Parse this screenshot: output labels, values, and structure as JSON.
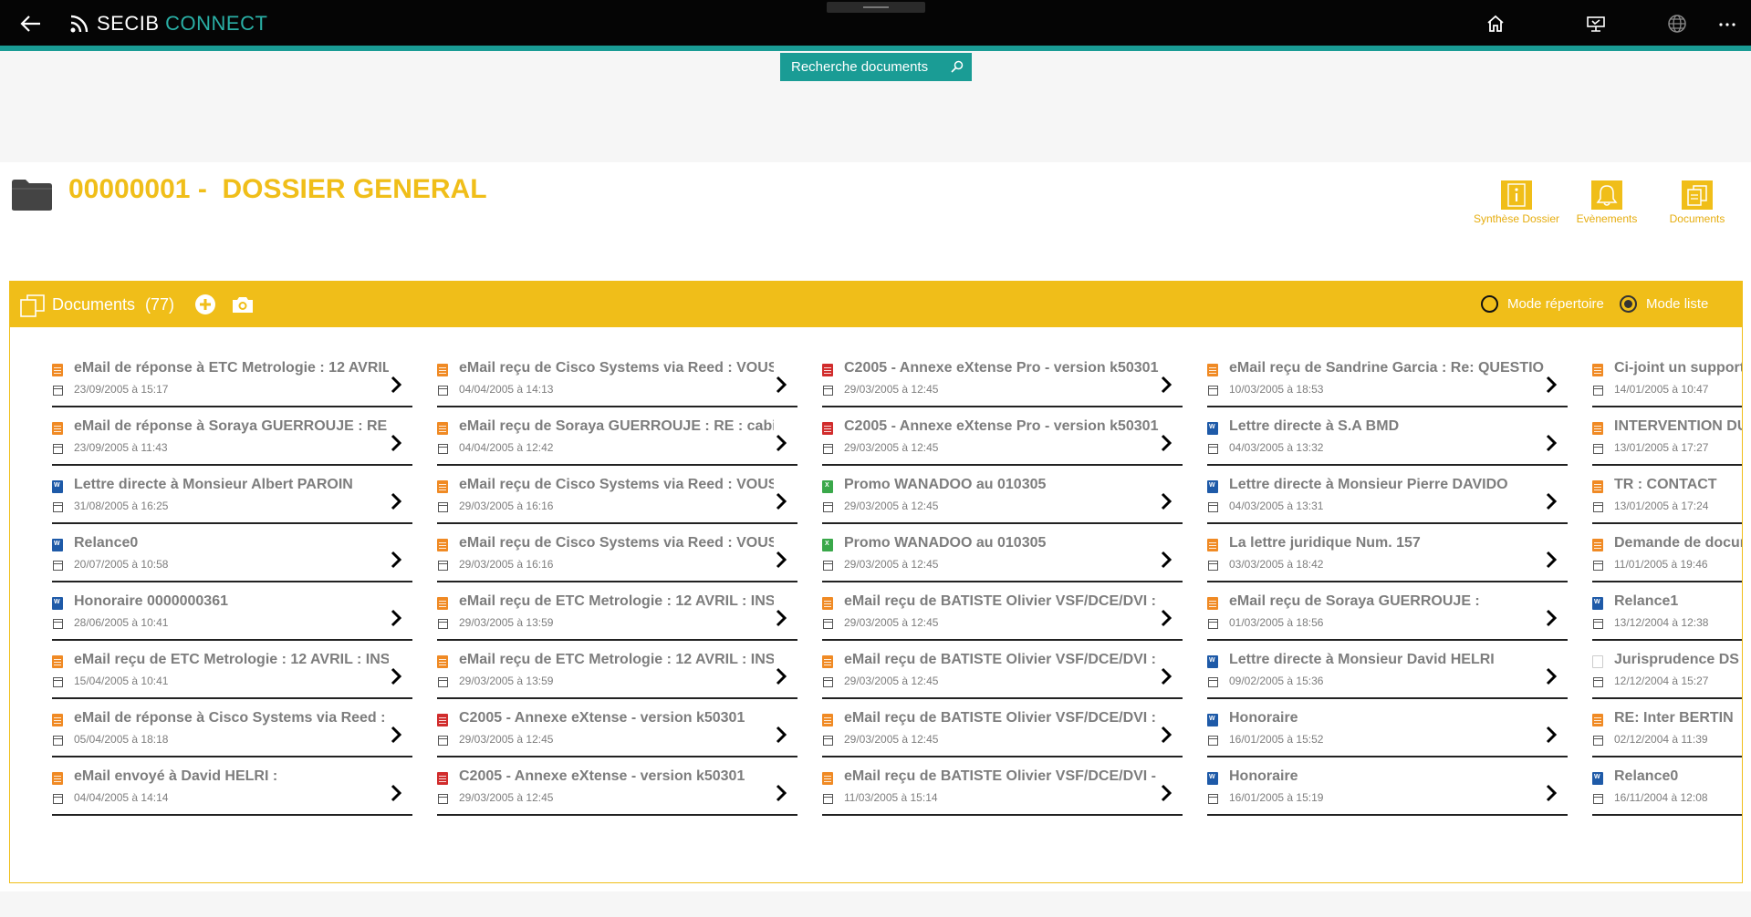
{
  "app": {
    "brand_part1": "SECIB",
    "brand_part2": "CONNECT"
  },
  "search": {
    "label": "Recherche documents"
  },
  "dossier": {
    "number": "00000001",
    "separator": " -  ",
    "name": "DOSSIER GENERAL"
  },
  "actions": [
    {
      "label": "Synthèse Dossier",
      "icon": "info-icon"
    },
    {
      "label": "Evènements",
      "icon": "bell-icon"
    },
    {
      "label": "Documents",
      "icon": "documents-icon"
    }
  ],
  "documents": {
    "title": "Documents",
    "count": "(77)",
    "mode_directory": "Mode répertoire",
    "mode_list": "Mode liste",
    "selected_mode": "list",
    "columns": [
      [
        {
          "title": "eMail de réponse à ETC Metrologie : 12 AVRIL",
          "date": "23/09/2005 à 15:17",
          "type": "email"
        },
        {
          "title": "eMail de réponse à Soraya GUERROUJE : RE :",
          "date": "23/09/2005 à 11:43",
          "type": "email"
        },
        {
          "title": "Lettre directe à Monsieur Albert PAROIN",
          "date": "31/08/2005 à 16:25",
          "type": "word"
        },
        {
          "title": "Relance0",
          "date": "20/07/2005 à 10:58",
          "type": "word"
        },
        {
          "title": "Honoraire 0000000361",
          "date": "28/06/2005 à 10:41",
          "type": "word"
        },
        {
          "title": "eMail reçu de ETC Metrologie : 12 AVRIL : INS",
          "date": "15/04/2005 à 10:41",
          "type": "email"
        },
        {
          "title": "eMail de réponse à Cisco Systems via Reed : V",
          "date": "05/04/2005 à 18:18",
          "type": "email"
        },
        {
          "title": "eMail envoyé à David HELRI :",
          "date": "04/04/2005 à 14:14",
          "type": "email"
        }
      ],
      [
        {
          "title": "eMail reçu de Cisco Systems via Reed : VOUS",
          "date": "04/04/2005 à 14:13",
          "type": "email"
        },
        {
          "title": "eMail reçu de Soraya GUERROUJE : RE : cabin",
          "date": "04/04/2005 à 12:42",
          "type": "email"
        },
        {
          "title": "eMail reçu de Cisco Systems via Reed : VOUS",
          "date": "29/03/2005 à 16:16",
          "type": "email"
        },
        {
          "title": "eMail reçu de Cisco Systems via Reed : VOUS",
          "date": "29/03/2005 à 16:16",
          "type": "email"
        },
        {
          "title": "eMail reçu de ETC Metrologie : 12 AVRIL : INS",
          "date": "29/03/2005 à 13:59",
          "type": "email"
        },
        {
          "title": "eMail reçu de ETC Metrologie : 12 AVRIL : INS",
          "date": "29/03/2005 à 13:59",
          "type": "email"
        },
        {
          "title": "C2005 - Annexe eXtense - version k50301",
          "date": "29/03/2005 à 12:45",
          "type": "pdf"
        },
        {
          "title": "C2005 - Annexe eXtense - version k50301",
          "date": "29/03/2005 à 12:45",
          "type": "pdf"
        }
      ],
      [
        {
          "title": "C2005 - Annexe eXtense Pro - version k50301",
          "date": "29/03/2005 à 12:45",
          "type": "pdf"
        },
        {
          "title": "C2005 - Annexe eXtense Pro - version k50301",
          "date": "29/03/2005 à 12:45",
          "type": "pdf"
        },
        {
          "title": "Promo WANADOO au 010305",
          "date": "29/03/2005 à 12:45",
          "type": "excel"
        },
        {
          "title": "Promo WANADOO au 010305",
          "date": "29/03/2005 à 12:45",
          "type": "excel"
        },
        {
          "title": "eMail reçu de BATISTE Olivier VSF/DCE/DVI :",
          "date": "29/03/2005 à 12:45",
          "type": "email"
        },
        {
          "title": "eMail reçu de BATISTE Olivier VSF/DCE/DVI :",
          "date": "29/03/2005 à 12:45",
          "type": "email"
        },
        {
          "title": "eMail reçu de BATISTE Olivier VSF/DCE/DVI :",
          "date": "29/03/2005 à 12:45",
          "type": "email"
        },
        {
          "title": "eMail reçu de BATISTE Olivier VSF/DCE/DVI -",
          "date": "11/03/2005 à 15:14",
          "type": "email"
        }
      ],
      [
        {
          "title": "eMail reçu de Sandrine Garcia : Re: QUESTIONS",
          "date": "10/03/2005 à 18:53",
          "type": "email"
        },
        {
          "title": "Lettre directe à S.A BMD",
          "date": "04/03/2005 à 13:32",
          "type": "word"
        },
        {
          "title": "Lettre directe à Monsieur Pierre DAVIDO",
          "date": "04/03/2005 à 13:31",
          "type": "word"
        },
        {
          "title": "La lettre juridique Num. 157",
          "date": "03/03/2005 à 18:42",
          "type": "email"
        },
        {
          "title": "eMail reçu de Soraya GUERROUJE :",
          "date": "01/03/2005 à 18:56",
          "type": "email"
        },
        {
          "title": "Lettre directe à Monsieur David HELRI",
          "date": "09/02/2005 à 15:36",
          "type": "word"
        },
        {
          "title": "Honoraire",
          "date": "16/01/2005 à 15:52",
          "type": "word"
        },
        {
          "title": "Honoraire",
          "date": "16/01/2005 à 15:19",
          "type": "word"
        }
      ],
      [
        {
          "title": "Ci-joint un support",
          "date": "14/01/2005 à 10:47",
          "type": "email"
        },
        {
          "title": "INTERVENTION DU",
          "date": "13/01/2005 à 17:27",
          "type": "email"
        },
        {
          "title": "TR : CONTACT",
          "date": "13/01/2005 à 17:24",
          "type": "email"
        },
        {
          "title": "Demande de document",
          "date": "11/01/2005 à 19:46",
          "type": "email"
        },
        {
          "title": "Relance1",
          "date": "13/12/2004 à 12:38",
          "type": "word"
        },
        {
          "title": "Jurisprudence DS D",
          "date": "12/12/2004 à 15:27",
          "type": "blank"
        },
        {
          "title": "RE: Inter BERTIN",
          "date": "02/12/2004 à 11:39",
          "type": "email"
        },
        {
          "title": "Relance0",
          "date": "16/11/2004 à 12:08",
          "type": "word"
        }
      ]
    ]
  },
  "colors": {
    "accent_yellow": "#f0be19",
    "teal": "#1a9c95",
    "topbar": "#050505"
  }
}
